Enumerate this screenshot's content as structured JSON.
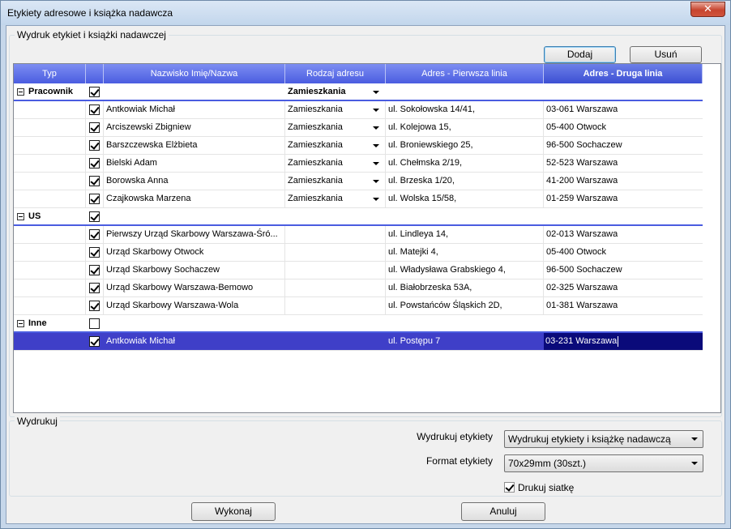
{
  "window": {
    "title": "Etykiety adresowe i książka nadawcza",
    "close_glyph": "✕"
  },
  "labels_group": {
    "label": "Wydruk etykiet i książki nadawczej"
  },
  "toolbar": {
    "add_label": "Dodaj",
    "remove_label": "Usuń"
  },
  "grid": {
    "columns": [
      "Typ",
      "",
      "Nazwisko Imię/Nazwa",
      "Rodzaj adresu",
      "Adres - Pierwsza linia",
      "Adres - Druga linia"
    ],
    "groups": [
      {
        "name": "Pracownik",
        "checked": true,
        "address_type": "Zamieszkania",
        "rows": [
          {
            "checked": true,
            "name": "Antkowiak Michał",
            "type": "Zamieszkania",
            "line1": "ul. Sokołowska 14/41,",
            "line2": "03-061 Warszawa"
          },
          {
            "checked": true,
            "name": "Arciszewski Zbigniew",
            "type": "Zamieszkania",
            "line1": "ul. Kolejowa 15,",
            "line2": "05-400 Otwock"
          },
          {
            "checked": true,
            "name": "Barszczewska Elżbieta",
            "type": "Zamieszkania",
            "line1": "ul. Broniewskiego 25,",
            "line2": "96-500 Sochaczew"
          },
          {
            "checked": true,
            "name": "Bielski Adam",
            "type": "Zamieszkania",
            "line1": "ul. Chełmska 2/19,",
            "line2": "52-523 Warszawa"
          },
          {
            "checked": true,
            "name": "Borowska Anna",
            "type": "Zamieszkania",
            "line1": "ul. Brzeska 1/20,",
            "line2": "41-200 Warszawa"
          },
          {
            "checked": true,
            "name": "Czajkowska Marzena",
            "type": "Zamieszkania",
            "line1": "ul. Wolska 15/58,",
            "line2": "01-259 Warszawa"
          }
        ]
      },
      {
        "name": "US",
        "checked": true,
        "address_type": "",
        "rows": [
          {
            "checked": true,
            "name": "Pierwszy Urząd Skarbowy Warszawa-Śró...",
            "type": "",
            "line1": "ul. Lindleya 14,",
            "line2": "02-013 Warszawa"
          },
          {
            "checked": true,
            "name": "Urząd Skarbowy Otwock",
            "type": "",
            "line1": "ul. Matejki 4,",
            "line2": "05-400 Otwock"
          },
          {
            "checked": true,
            "name": "Urząd Skarbowy Sochaczew",
            "type": "",
            "line1": "ul. Władysława Grabskiego 4,",
            "line2": "96-500 Sochaczew"
          },
          {
            "checked": true,
            "name": "Urząd Skarbowy Warszawa-Bemowo",
            "type": "",
            "line1": "ul. Białobrzeska 53A,",
            "line2": "02-325 Warszawa"
          },
          {
            "checked": true,
            "name": "Urząd Skarbowy Warszawa-Wola",
            "type": "",
            "line1": "ul. Powstańców Śląskich 2D,",
            "line2": "01-381 Warszawa"
          }
        ]
      },
      {
        "name": "Inne",
        "checked": false,
        "address_type": "",
        "rows": [
          {
            "checked": true,
            "name": "Antkowiak Michał",
            "type": "",
            "line1": "ul. Postępu 7",
            "line2": "03-231 Warszawa",
            "selected": true
          }
        ]
      }
    ]
  },
  "print_group": {
    "label": "Wydrukuj",
    "print_labels_label": "Wydrukuj etykiety",
    "print_labels_value": "Wydrukuj etykiety i książkę nadawczą",
    "format_label": "Format etykiety",
    "format_value": "70x29mm (30szt.)",
    "grid_label": "Drukuj siatkę",
    "grid_checked": true
  },
  "footer": {
    "execute_label": "Wykonaj",
    "cancel_label": "Anuluj"
  }
}
